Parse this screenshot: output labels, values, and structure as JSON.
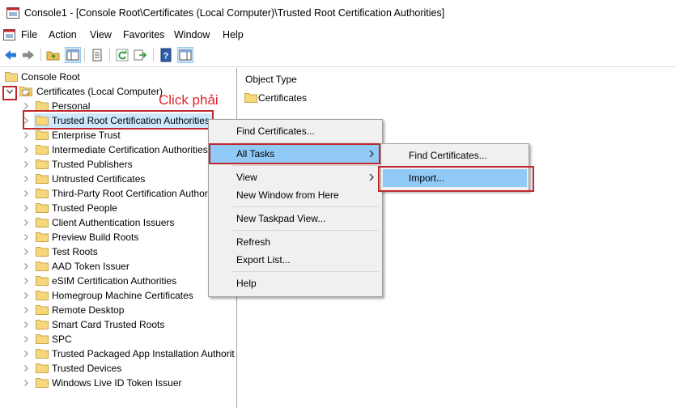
{
  "window": {
    "title": "Console1 - [Console Root\\Certificates (Local Computer)\\Trusted Root Certification Authorities]"
  },
  "menubar": {
    "items": [
      "File",
      "Action",
      "View",
      "Favorites",
      "Window",
      "Help"
    ]
  },
  "toolbar": {
    "buttons": [
      "back-arrow-icon",
      "forward-arrow-icon",
      "up-folder-icon",
      "show-hide-tree-icon",
      "properties-icon",
      "refresh-icon",
      "export-list-icon",
      "help-icon",
      "action-pane-icon"
    ]
  },
  "tree": {
    "root": "Console Root",
    "certificates": "Certificates (Local Computer)",
    "stores": [
      "Personal",
      "Trusted Root Certification Authorities",
      "Enterprise Trust",
      "Intermediate Certification Authorities",
      "Trusted Publishers",
      "Untrusted Certificates",
      "Third-Party Root Certification Authori",
      "Trusted People",
      "Client Authentication Issuers",
      "Preview Build Roots",
      "Test Roots",
      "AAD Token Issuer",
      "eSIM Certification Authorities",
      "Homegroup Machine Certificates",
      "Remote Desktop",
      "Smart Card Trusted Roots",
      "SPC",
      "Trusted Packaged App Installation Authorit",
      "Trusted Devices",
      "Windows Live ID Token Issuer"
    ]
  },
  "annotation": {
    "text": "Click phải",
    "color": "#e0262d"
  },
  "right_pane": {
    "column_header": "Object Type",
    "items": [
      "Certificates"
    ]
  },
  "context_menu": {
    "find": "Find Certificates...",
    "all_tasks": "All Tasks",
    "view": "View",
    "new_window": "New Window from Here",
    "new_taskpad": "New Taskpad View...",
    "refresh": "Refresh",
    "export": "Export List...",
    "help": "Help"
  },
  "submenu": {
    "find": "Find Certificates...",
    "import": "Import..."
  },
  "colors": {
    "highlight": "#91c9f7",
    "selection": "#cce8ff",
    "annotation_box": "#c0282d"
  }
}
